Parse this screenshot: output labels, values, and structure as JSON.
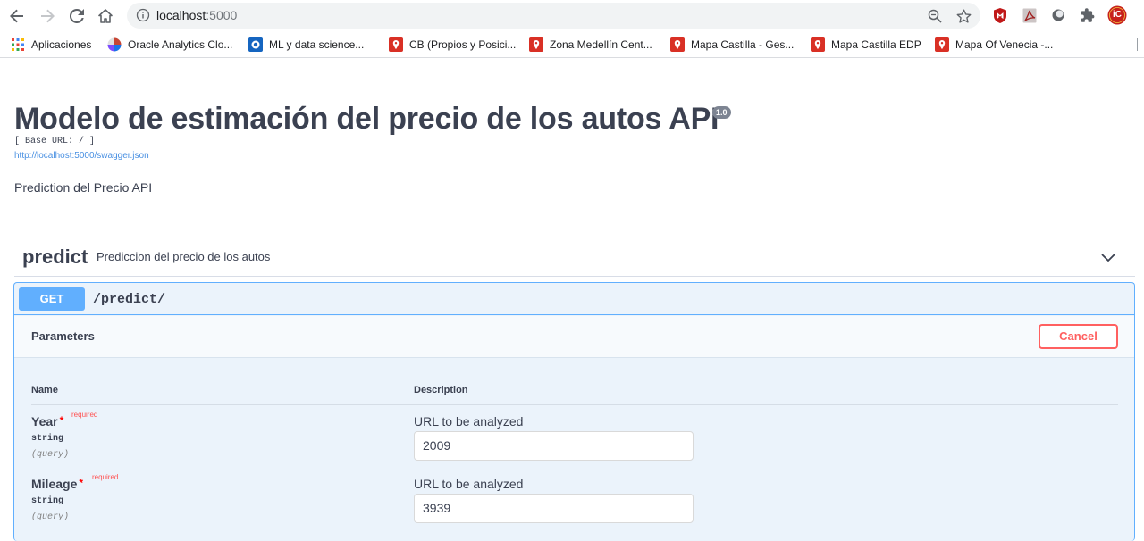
{
  "browser": {
    "url_host": "localhost",
    "url_port": ":5000",
    "bookmarks": [
      {
        "label": "Aplicaciones",
        "icon": "apps-grid-icon"
      },
      {
        "label": "Oracle Analytics Clo...",
        "icon": "oracle-icon"
      },
      {
        "label": "ML y data science...",
        "icon": "ml-icon"
      },
      {
        "label": "CB (Propios y Posici...",
        "icon": "map-pin-icon"
      },
      {
        "label": "Zona Medellín Cent...",
        "icon": "map-pin-icon"
      },
      {
        "label": "Mapa Castilla - Ges...",
        "icon": "map-pin-icon"
      },
      {
        "label": "Mapa Castilla EDP",
        "icon": "map-pin-icon"
      },
      {
        "label": "Mapa Of Venecia -...",
        "icon": "map-pin-icon"
      }
    ],
    "profile_initials": "iC"
  },
  "api": {
    "title": "Modelo de estimación del precio de los autos API",
    "version": "1.0",
    "base_url": "[ Base URL: / ]",
    "spec_link": "http://localhost:5000/swagger.json",
    "description": "Prediction del Precio API"
  },
  "tag": {
    "name": "predict",
    "description": "Prediccion del precio de los autos"
  },
  "operation": {
    "method": "GET",
    "path": "/predict/",
    "parameters_title": "Parameters",
    "cancel_label": "Cancel",
    "col_name": "Name",
    "col_description": "Description",
    "params": [
      {
        "name": "Year",
        "star": "*",
        "required": "required",
        "type": "string",
        "in": "(query)",
        "description": "URL to be analyzed",
        "value": "2009"
      },
      {
        "name": "Mileage",
        "star": "*",
        "required": "required",
        "type": "string",
        "in": "(query)",
        "description": "URL to be analyzed",
        "value": "3939"
      }
    ]
  },
  "colors": {
    "get_blue": "#61affe",
    "op_bg": "#ebf3fb",
    "cancel_red": "#ff6060",
    "title": "#3b4151"
  }
}
